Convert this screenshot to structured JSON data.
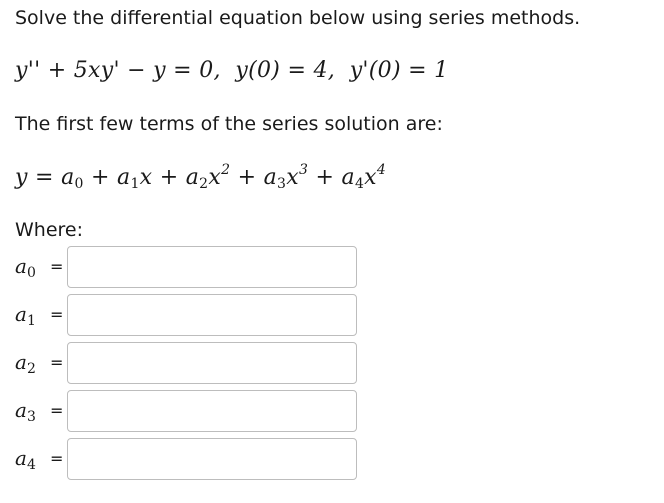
{
  "instructions": "Solve the differential equation below using series methods.",
  "equation": {
    "lhs": "y'' + 5xy' − y = 0,",
    "ic1": "y(0) = 4,",
    "ic2": "y'(0) = 1"
  },
  "series_intro": "The first few terms of the series solution are:",
  "series": {
    "y": "y",
    "eq": "=",
    "plus": "+",
    "a": "a",
    "x": "x",
    "sub0": "0",
    "sub1": "1",
    "sub2": "2",
    "sub3": "3",
    "sub4": "4",
    "pow2": "2",
    "pow3": "3",
    "pow4": "4"
  },
  "where_label": "Where:",
  "coefficients": [
    {
      "var": "a",
      "sub": "0",
      "eq": "=",
      "value": ""
    },
    {
      "var": "a",
      "sub": "1",
      "eq": "=",
      "value": ""
    },
    {
      "var": "a",
      "sub": "2",
      "eq": "=",
      "value": ""
    },
    {
      "var": "a",
      "sub": "3",
      "eq": "=",
      "value": ""
    },
    {
      "var": "a",
      "sub": "4",
      "eq": "=",
      "value": ""
    }
  ]
}
